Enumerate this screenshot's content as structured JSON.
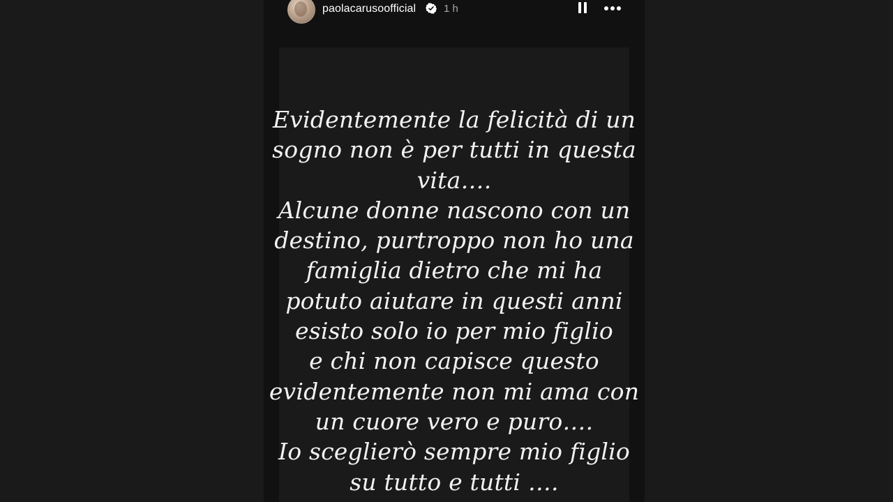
{
  "story": {
    "author": {
      "username": "paolacarusoofficial",
      "verified": true,
      "posted_ago": "1 h"
    },
    "controls": {
      "pause_icon": "pause-icon",
      "more_icon": "more-horizontal-icon"
    },
    "text_lines": [
      "Evidentemente la felicità di un",
      "sogno non è per tutti in questa",
      "vita….",
      "Alcune donne nascono con un",
      "destino, purtroppo non ho una",
      "famiglia dietro che mi ha",
      "potuto aiutare in questi anni",
      "esisto solo io per mio figlio",
      "e chi non capisce questo",
      "evidentemente non mi ama con",
      "un cuore vero e puro….",
      "Io sceglierò sempre mio figlio",
      "su tutto e tutti …."
    ]
  },
  "colors": {
    "background": "#1a1a1a",
    "story_frame": "#111111",
    "text": "#f2f2f2",
    "timestamp": "#a8a8a8",
    "verified_badge": "#ffffff"
  }
}
